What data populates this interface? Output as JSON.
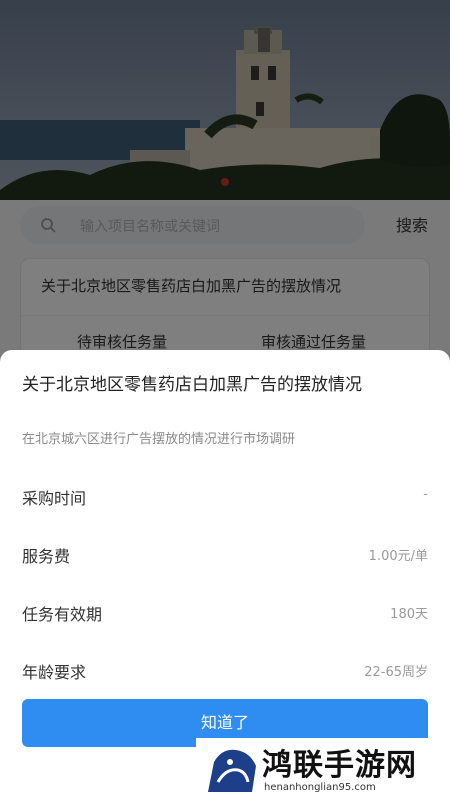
{
  "search": {
    "placeholder": "输入项目名称或关键词",
    "button_label": "搜索"
  },
  "task_card": {
    "title": "关于北京地区零售药店白加黑广告的摆放情况",
    "stats": {
      "pending_label": "待审核任务量",
      "passed_label": "审核通过任务量"
    }
  },
  "sheet": {
    "title": "关于北京地区零售药店白加黑广告的摆放情况",
    "description": "在北京城六区进行广告摆放的情况进行市场调研",
    "rows": [
      {
        "label": "采购时间",
        "value": "-"
      },
      {
        "label": "服务费",
        "value": "1.00元/单"
      },
      {
        "label": "任务有效期",
        "value": "180天"
      },
      {
        "label": "年龄要求",
        "value": "22-65周岁"
      }
    ],
    "confirm_label": "知道了"
  },
  "watermark": {
    "text": "鸿联手游网",
    "url": "henanhonglian95.com"
  },
  "colors": {
    "primary": "#2f8cf0",
    "overlay": "rgba(0,0,0,0.5)"
  }
}
